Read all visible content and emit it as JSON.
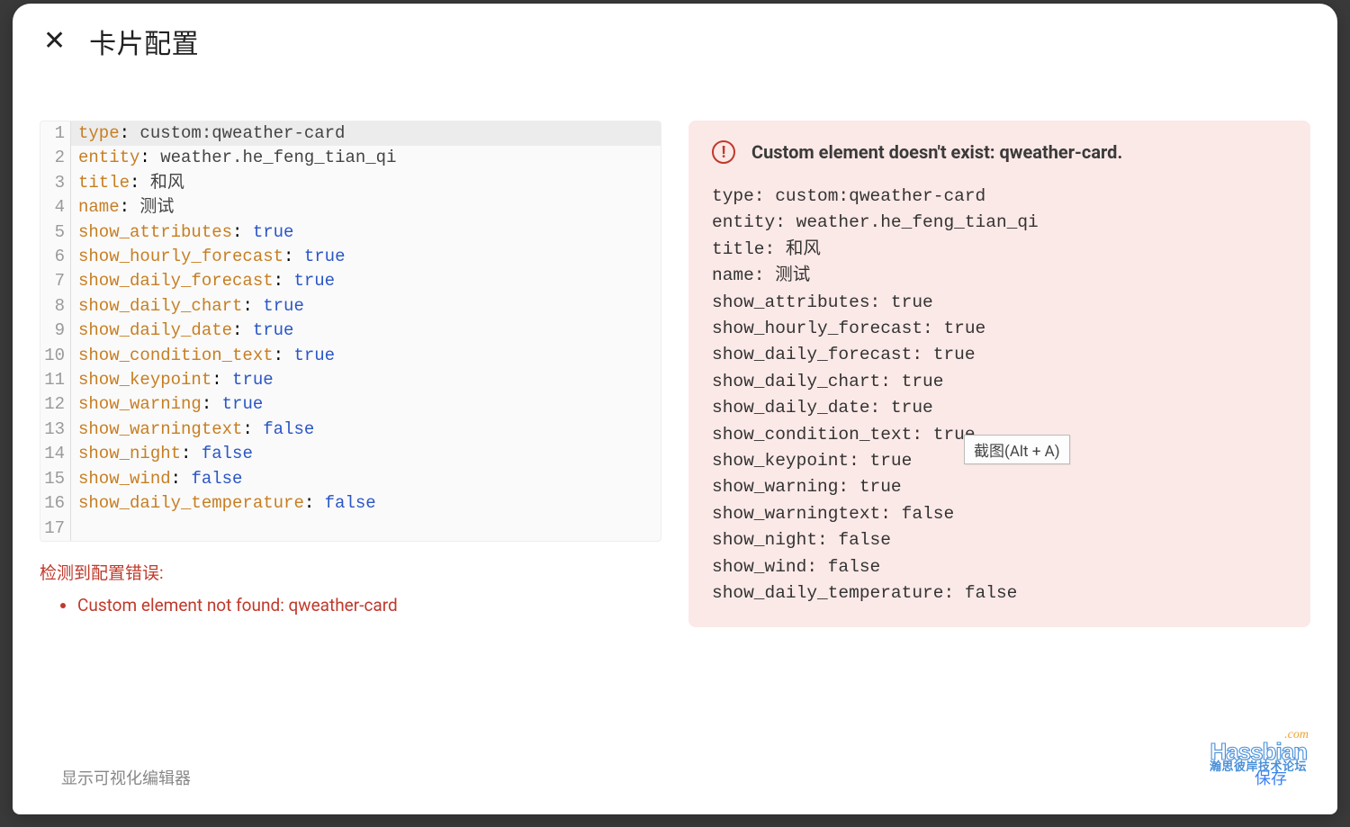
{
  "dialog": {
    "title": "卡片配置",
    "close_glyph": "✕"
  },
  "editor_lines": [
    {
      "n": "1",
      "key": "type",
      "sep": ": ",
      "val": "custom:qweather-card",
      "vtype": "str"
    },
    {
      "n": "2",
      "key": "entity",
      "sep": ": ",
      "val": "weather.he_feng_tian_qi",
      "vtype": "str"
    },
    {
      "n": "3",
      "key": "title",
      "sep": ": ",
      "val": "和风",
      "vtype": "str"
    },
    {
      "n": "4",
      "key": "name",
      "sep": ": ",
      "val": "测试",
      "vtype": "str"
    },
    {
      "n": "5",
      "key": "show_attributes",
      "sep": ": ",
      "val": "true",
      "vtype": "bool"
    },
    {
      "n": "6",
      "key": "show_hourly_forecast",
      "sep": ": ",
      "val": "true",
      "vtype": "bool"
    },
    {
      "n": "7",
      "key": "show_daily_forecast",
      "sep": ": ",
      "val": "true",
      "vtype": "bool"
    },
    {
      "n": "8",
      "key": "show_daily_chart",
      "sep": ": ",
      "val": "true",
      "vtype": "bool"
    },
    {
      "n": "9",
      "key": "show_daily_date",
      "sep": ": ",
      "val": "true",
      "vtype": "bool"
    },
    {
      "n": "10",
      "key": "show_condition_text",
      "sep": ": ",
      "val": "true",
      "vtype": "bool"
    },
    {
      "n": "11",
      "key": "show_keypoint",
      "sep": ": ",
      "val": "true",
      "vtype": "bool"
    },
    {
      "n": "12",
      "key": "show_warning",
      "sep": ": ",
      "val": "true",
      "vtype": "bool"
    },
    {
      "n": "13",
      "key": "show_warningtext",
      "sep": ": ",
      "val": "false",
      "vtype": "bool"
    },
    {
      "n": "14",
      "key": "show_night",
      "sep": ": ",
      "val": "false",
      "vtype": "bool"
    },
    {
      "n": "15",
      "key": "show_wind",
      "sep": ": ",
      "val": "false",
      "vtype": "bool"
    },
    {
      "n": "16",
      "key": "show_daily_temperature",
      "sep": ": ",
      "val": "false",
      "vtype": "bool"
    },
    {
      "n": "17",
      "key": "",
      "sep": "",
      "val": "",
      "vtype": "str"
    }
  ],
  "config_error": {
    "heading": "检测到配置错误:",
    "items": [
      "Custom element not found: qweather-card"
    ]
  },
  "preview_error": {
    "title": "Custom element doesn't exist: qweather-card.",
    "yaml_lines": [
      "type: custom:qweather-card",
      "entity: weather.he_feng_tian_qi",
      "title: 和风",
      "name: 测试",
      "show_attributes: true",
      "show_hourly_forecast: true",
      "show_daily_forecast: true",
      "show_daily_chart: true",
      "show_daily_date: true",
      "show_condition_text: true",
      "show_keypoint: true",
      "show_warning: true",
      "show_warningtext: false",
      "show_night: false",
      "show_wind: false",
      "show_daily_temperature: false"
    ],
    "tooltip": "截图(Alt + A)"
  },
  "footer": {
    "visual_editor": "显示可视化编辑器",
    "save": "保存"
  },
  "watermark": {
    "com": ".com",
    "main": "Hassbian",
    "sub": "瀚思彼岸技术论坛"
  }
}
